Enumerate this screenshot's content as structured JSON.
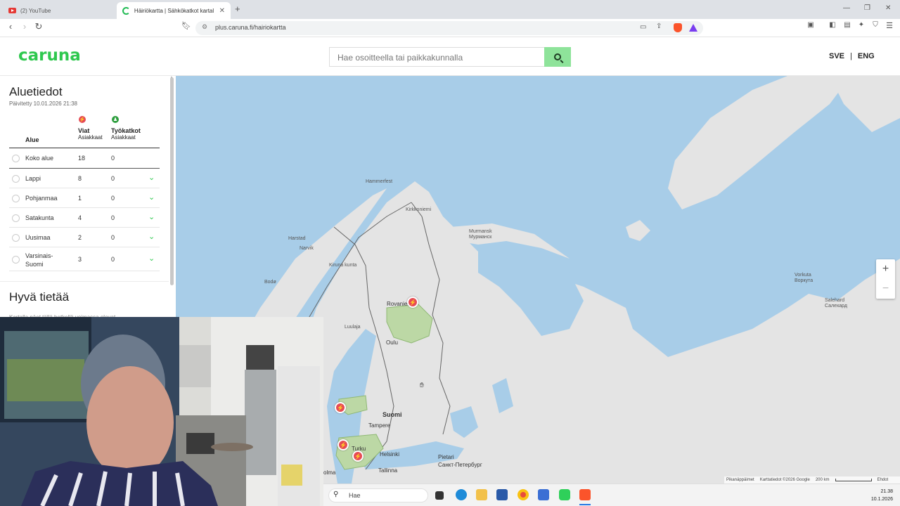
{
  "browser": {
    "tabs": [
      {
        "title": "(2) YouTube",
        "icon": "youtube-icon"
      },
      {
        "title": "Häiriökartta | Sähkökatkot kartal",
        "icon": "caruna-icon"
      }
    ],
    "url": "plus.caruna.fi/hairiokartta"
  },
  "site": {
    "logo": "caruna",
    "search_placeholder": "Hae osoitteella tai paikkakunnalla",
    "lang_sve": "SVE",
    "lang_sep": "|",
    "lang_eng": "ENG"
  },
  "panel": {
    "title": "Aluetiedot",
    "updated": "Päivitetty 10.01.2026 21:38",
    "col_area": "Alue",
    "col_faults": "Viat",
    "col_faults_sub": "Asiakkaat",
    "col_work": "Työkatkot",
    "col_work_sub": "Asiakkaat",
    "rows": [
      {
        "name": "Koko alue",
        "faults": "18",
        "work": "0"
      },
      {
        "name": "Lappi",
        "faults": "8",
        "work": "0"
      },
      {
        "name": "Pohjanmaa",
        "faults": "1",
        "work": "0"
      },
      {
        "name": "Satakunta",
        "faults": "4",
        "work": "0"
      },
      {
        "name": "Uusimaa",
        "faults": "2",
        "work": "0"
      },
      {
        "name": "Varsinais-Suomi",
        "faults": "3",
        "work": "0"
      }
    ],
    "good_to_know": "Hyvä tietää",
    "good_to_know_text": "Kartalla näet tällä hetkellä voimassa olevat..."
  },
  "map": {
    "labels": {
      "hammerfest": "Hammerfest",
      "kirkkoniemi": "Kirkkoniemi",
      "murmansk": "Murmansk",
      "murmansk_ru": "Мурманск",
      "harstad": "Harstad",
      "narvik": "Narvik",
      "kiruna": "Kiruna kunta",
      "bodo": "Bodø",
      "rovaniemi": "Rovaniemi",
      "luulaja": "Luulaja",
      "oulu": "Oulu",
      "suomi": "Suomi",
      "tampere": "Tampere",
      "turku": "Turku",
      "helsinki": "Helsinki",
      "tallinna": "Tallinna",
      "pietari": "Pietari",
      "pietari_ru": "Санкт-Петербург",
      "olma": "olma",
      "vorkuta": "Vorkuta",
      "vorkuta_ru": "Воркута",
      "salehard": "Salehard",
      "salehard_ru": "Салехард"
    },
    "zoom_in": "+",
    "zoom_out": "−",
    "attribution": {
      "shortcuts": "Pikanäppäimet",
      "data": "Karttatiedot ©2026 Google",
      "scale": "200 km",
      "terms": "Ehdot"
    }
  },
  "taskbar": {
    "search": "Hae",
    "time": "21.38",
    "date": "10.1.2026"
  },
  "colors": {
    "brand_green": "#2ec84e",
    "fault_red": "#e64b55",
    "work_green": "#2e9e3e",
    "water": "#a8cde8",
    "land": "#e4e4e4"
  }
}
